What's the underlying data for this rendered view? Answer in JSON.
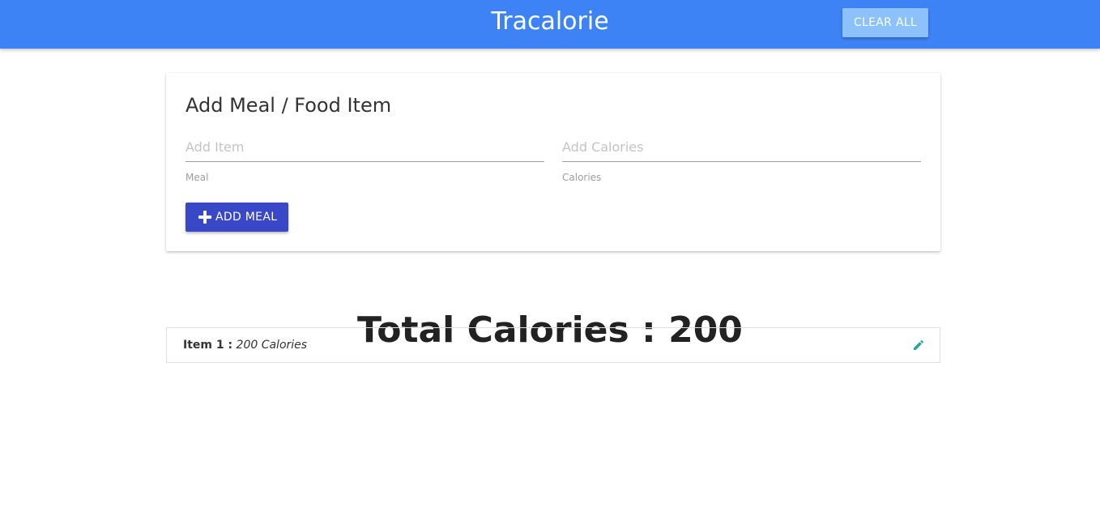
{
  "header": {
    "brand": "Tracalorie",
    "clear_all_label": "CLEAR ALL"
  },
  "form": {
    "title": "Add Meal / Food Item",
    "item_input": {
      "placeholder": "Add Item",
      "value": "",
      "label": "Meal"
    },
    "calories_input": {
      "placeholder": "Add Calories",
      "value": "",
      "label": "Calories"
    },
    "add_button_label": "ADD MEAL",
    "add_button_icon": "plus-icon"
  },
  "total": {
    "label": "Total Calories",
    "separator": ":",
    "value": "200"
  },
  "items": [
    {
      "name": "Item 1 :",
      "calories": "200 Calories",
      "action_icon": "pencil-icon"
    }
  ],
  "colors": {
    "navbar": "#3d83f5",
    "clear_button": "#8cc1fb",
    "add_button": "#3848c7",
    "edit_icon": "#26a69a"
  }
}
